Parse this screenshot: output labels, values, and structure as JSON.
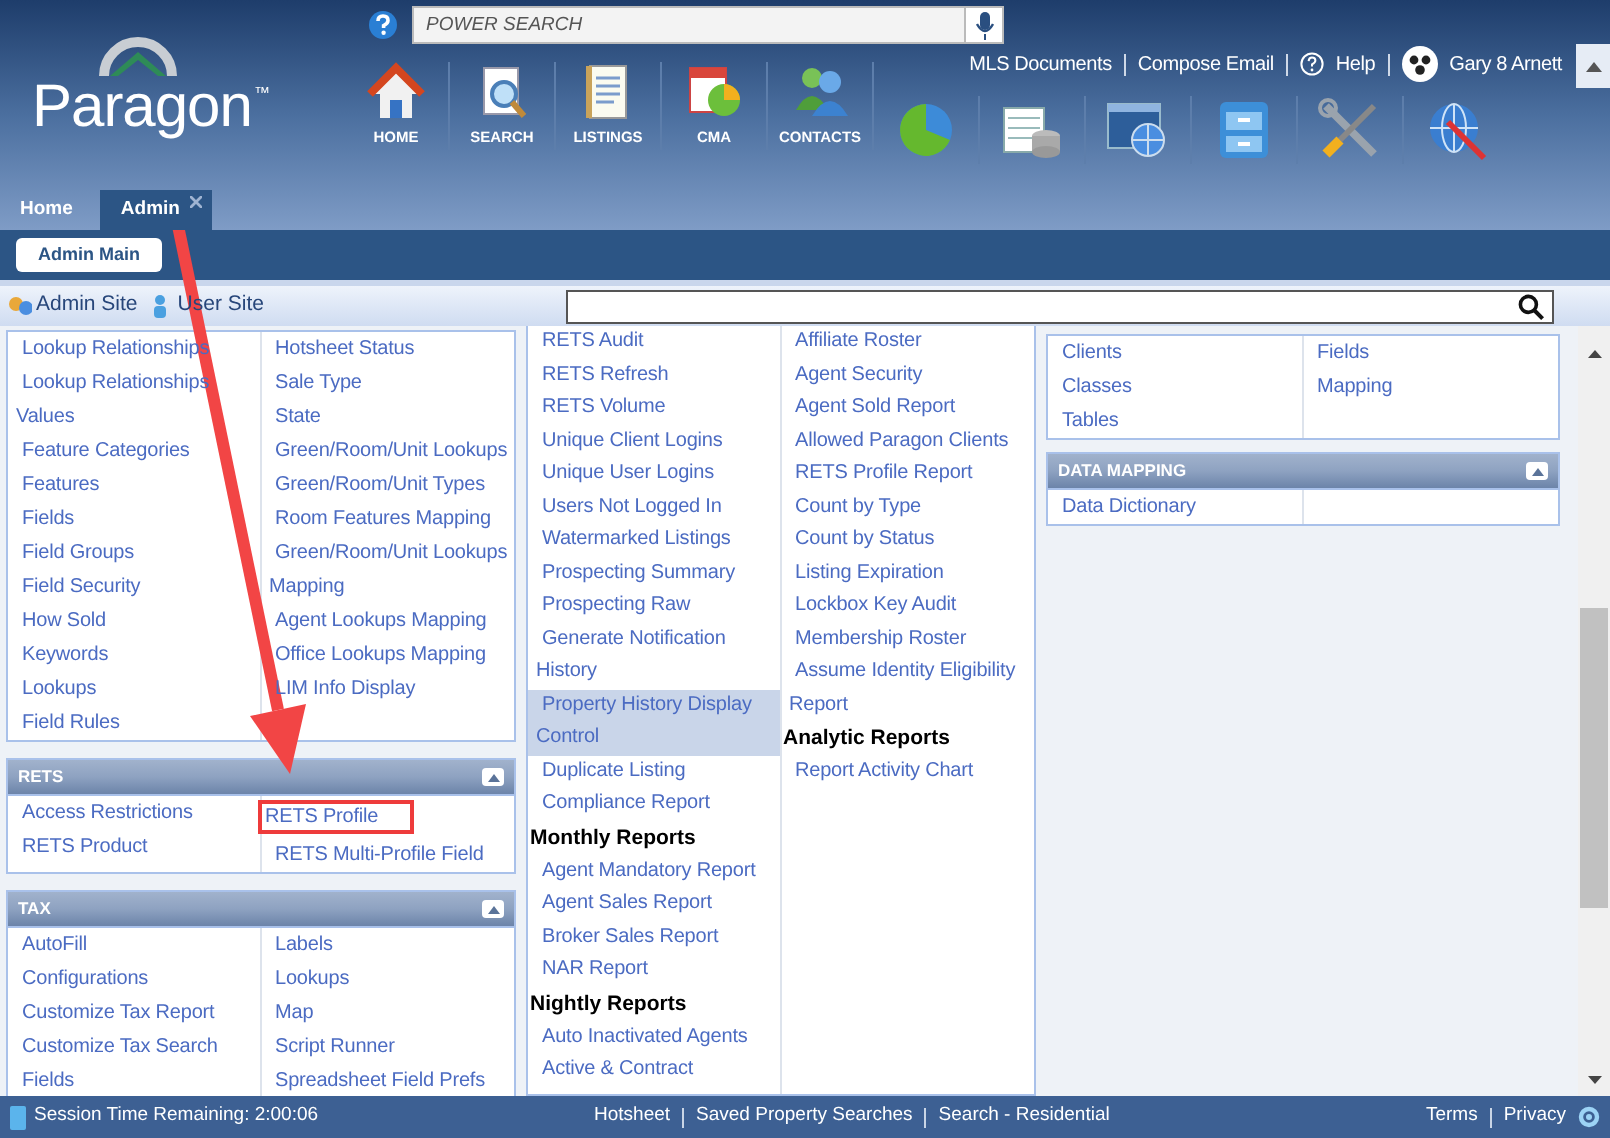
{
  "header": {
    "logo": "Paragon",
    "logo_mark": "™",
    "power_search": {
      "placeholder": "POWER SEARCH"
    },
    "links": [
      "MLS Documents",
      "Compose Email",
      "Help"
    ],
    "user": "Gary 8 Arnett",
    "nav": [
      "HOME",
      "SEARCH",
      "LISTINGS",
      "CMA",
      "CONTACTS"
    ]
  },
  "tabs": [
    {
      "label": "Home",
      "selected": false,
      "closable": false
    },
    {
      "label": "Admin",
      "selected": true,
      "closable": true
    }
  ],
  "subtabs": [
    {
      "label": "Admin Main",
      "selected": true
    }
  ],
  "toolbar": {
    "links": [
      "Admin Site",
      "User Site"
    ]
  },
  "columns": [
    [
      {
        "columns": [
          [
            "Lookup Relationships",
            "Lookup Relationships Values",
            "Feature Categories",
            "Features",
            "Fields",
            "Field Groups",
            "Field Security",
            "How Sold",
            "Keywords",
            "Lookups",
            "Field Rules"
          ],
          [
            "Hotsheet Status",
            "Sale Type",
            "State",
            "Green/Room/Unit Lookups",
            "Green/Room/Unit Types",
            "Room Features Mapping",
            "Green/Room/Unit Lookups Mapping",
            "Agent Lookups Mapping",
            "Office Lookups Mapping",
            "LIM Info Display"
          ]
        ]
      },
      {
        "title": "RETS",
        "columns": [
          [
            {
              "kind": "link",
              "label": "Access Restrictions",
              "marked": false
            },
            {
              "kind": "link",
              "label": "RETS Product",
              "marked": false
            }
          ],
          [
            {
              "kind": "link",
              "label": "RETS Profile",
              "marked": true
            },
            {
              "kind": "link",
              "label": "RETS Multi-Profile Field",
              "marked": false
            }
          ]
        ]
      },
      {
        "title": "TAX",
        "columns": [
          [
            "AutoFill",
            "Configurations",
            "Customize Tax Report",
            "Customize Tax Search",
            "Fields"
          ],
          [
            "Labels",
            "Lookups",
            "Map",
            "Script Runner",
            "Spreadsheet Field Prefs"
          ]
        ]
      }
    ],
    [
      {
        "columns": [
          [
            {
              "kind": "link",
              "label": "RETS Audit",
              "selected": false
            },
            {
              "kind": "link",
              "label": "RETS Refresh",
              "selected": false
            },
            {
              "kind": "link",
              "label": "RETS Volume",
              "selected": false
            },
            {
              "kind": "link",
              "label": "Unique Client Logins",
              "selected": false
            },
            {
              "kind": "link",
              "label": "Unique User Logins",
              "selected": false
            },
            {
              "kind": "link",
              "label": "Users Not Logged In",
              "selected": false
            },
            {
              "kind": "link",
              "label": "Watermarked Listings",
              "selected": false
            },
            {
              "kind": "link",
              "label": "Prospecting Summary",
              "selected": false
            },
            {
              "kind": "link",
              "label": "Prospecting Raw",
              "selected": false
            },
            {
              "kind": "link",
              "label": "Generate Notification History",
              "selected": false
            },
            {
              "kind": "link",
              "label": "Property History Display Control",
              "selected": true
            },
            {
              "kind": "link",
              "label": "Duplicate Listing",
              "selected": false
            },
            {
              "kind": "link",
              "label": "Compliance Report",
              "selected": false
            },
            {
              "kind": "heading",
              "label": "Monthly Reports",
              "selected": false
            },
            {
              "kind": "link",
              "label": "Agent Mandatory Report",
              "selected": false
            },
            {
              "kind": "link",
              "label": "Agent Sales Report",
              "selected": false
            },
            {
              "kind": "link",
              "label": "Broker Sales Report",
              "selected": false
            },
            {
              "kind": "link",
              "label": "NAR Report",
              "selected": false
            },
            {
              "kind": "heading",
              "label": "Nightly Reports",
              "selected": false
            },
            {
              "kind": "link",
              "label": "Auto Inactivated Agents",
              "selected": false
            },
            {
              "kind": "link",
              "label": "Active & Contract",
              "selected": false
            }
          ],
          [
            {
              "kind": "link",
              "label": "Affiliate Roster"
            },
            {
              "kind": "link",
              "label": "Agent Security"
            },
            {
              "kind": "link",
              "label": "Agent Sold Report"
            },
            {
              "kind": "link",
              "label": "Allowed Paragon Clients"
            },
            {
              "kind": "link",
              "label": "RETS Profile Report"
            },
            {
              "kind": "link",
              "label": "Count by Type"
            },
            {
              "kind": "link",
              "label": "Count by Status"
            },
            {
              "kind": "link",
              "label": "Listing Expiration"
            },
            {
              "kind": "link",
              "label": "Lockbox Key Audit"
            },
            {
              "kind": "link",
              "label": "Membership Roster"
            },
            {
              "kind": "link",
              "label": "Assume Identity Eligibility Report"
            },
            {
              "kind": "heading",
              "label": "Analytic Reports"
            },
            {
              "kind": "link",
              "label": "Report Activity Chart"
            }
          ]
        ]
      }
    ],
    [
      {
        "columns": [
          [
            "Clients",
            "Classes",
            "Tables"
          ],
          [
            "Fields",
            "Mapping"
          ]
        ]
      },
      {
        "title": "DATA MAPPING",
        "columns": [
          [
            "Data Dictionary"
          ],
          []
        ]
      }
    ]
  ],
  "status_bar": {
    "session": "Session Time Remaining: 2:00:06",
    "links": [
      "Hotsheet",
      "Saved Property Searches",
      "Search - Residential"
    ],
    "right_links": [
      "Terms",
      "Privacy"
    ]
  }
}
